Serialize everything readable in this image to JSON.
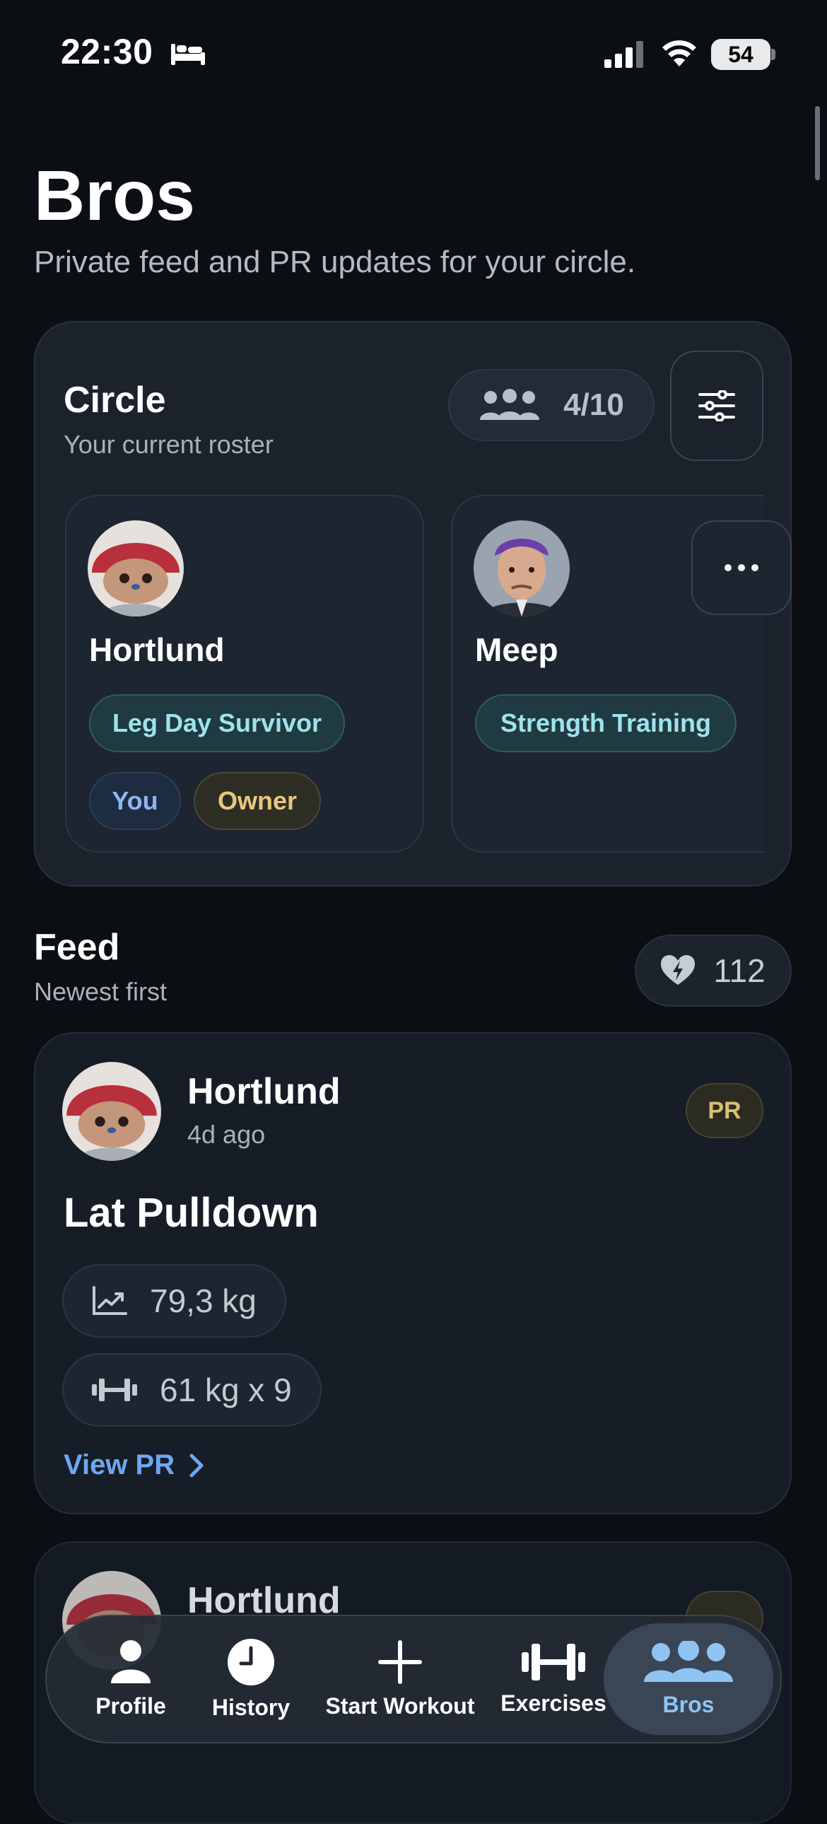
{
  "status_bar": {
    "time": "22:30",
    "battery": "54",
    "icons": [
      "bed-icon",
      "signal-icon",
      "wifi-icon",
      "battery-icon"
    ]
  },
  "header": {
    "title": "Bros",
    "subtitle": "Private feed and PR updates for your circle."
  },
  "circle": {
    "title": "Circle",
    "subtitle": "Your current roster",
    "count": "4/10",
    "members": [
      {
        "name": "Hortlund",
        "tags": [
          "Leg Day Survivor"
        ],
        "badges": [
          "You",
          "Owner"
        ]
      },
      {
        "name": "Meep",
        "tags": [
          "Strength Training"
        ],
        "badges": []
      }
    ]
  },
  "feed": {
    "title": "Feed",
    "subtitle": "Newest first",
    "likes": "112",
    "posts": [
      {
        "author": "Hortlund",
        "time": "4d ago",
        "badge": "PR",
        "exercise": "Lat Pulldown",
        "estimate": "79,3 kg",
        "set": "61 kg x 9",
        "link": "View PR"
      },
      {
        "author": "Hortlund",
        "badge": "PR"
      }
    ]
  },
  "tabbar": {
    "active": "Bros",
    "tabs": [
      {
        "label": "Profile",
        "icon": "person-icon"
      },
      {
        "label": "History",
        "icon": "clock-icon"
      },
      {
        "label": "Start Workout",
        "icon": "plus-icon"
      },
      {
        "label": "Exercises",
        "icon": "dumbbell-icon"
      },
      {
        "label": "Bros",
        "icon": "group-icon"
      }
    ]
  },
  "colors": {
    "background": "#0b0f14",
    "accent_blue": "#6fa6f0",
    "tab_active": "#8fc4f2"
  }
}
